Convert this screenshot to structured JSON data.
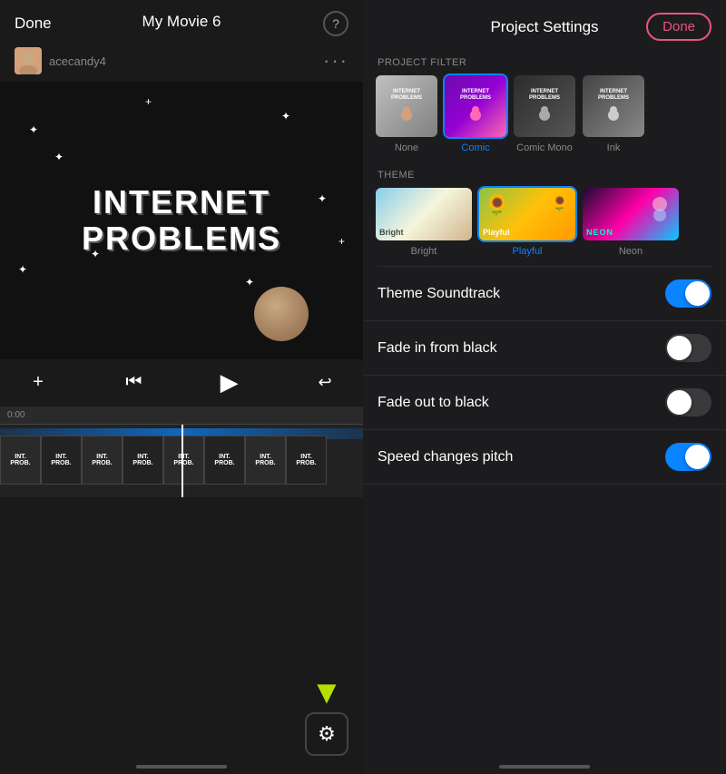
{
  "left": {
    "done_label": "Done",
    "movie_title": "My Movie 6",
    "username": "acecandy4",
    "video_line1": "INTERNET",
    "video_line2": "PROBLEMS",
    "help_icon": "?",
    "more_icon": "···",
    "add_icon": "+",
    "settings_icon": "⚙"
  },
  "right": {
    "title": "Project Settings",
    "done_label": "Done",
    "filter_section_label": "PROJECT FILTER",
    "theme_section_label": "THEME",
    "filters": [
      {
        "name": "None",
        "selected": false,
        "style": "filter-none"
      },
      {
        "name": "Comic",
        "selected": true,
        "style": "filter-comic"
      },
      {
        "name": "Comic Mono",
        "selected": false,
        "style": "filter-comic-mono"
      },
      {
        "name": "Ink",
        "selected": false,
        "style": "filter-ink"
      }
    ],
    "themes": [
      {
        "name": "Bright",
        "selected": false,
        "style": "bright-bg",
        "label": "Bright"
      },
      {
        "name": "Playful",
        "selected": true,
        "style": "sunflower-bg",
        "label": "Playful"
      },
      {
        "name": "Neon",
        "selected": false,
        "style": "neon-bg",
        "label": "NEON"
      }
    ],
    "toggles": [
      {
        "label": "Theme Soundtrack",
        "on": true
      },
      {
        "label": "Fade in from black",
        "on": false
      },
      {
        "label": "Fade out to black",
        "on": false
      },
      {
        "label": "Speed changes pitch",
        "on": true
      }
    ]
  }
}
